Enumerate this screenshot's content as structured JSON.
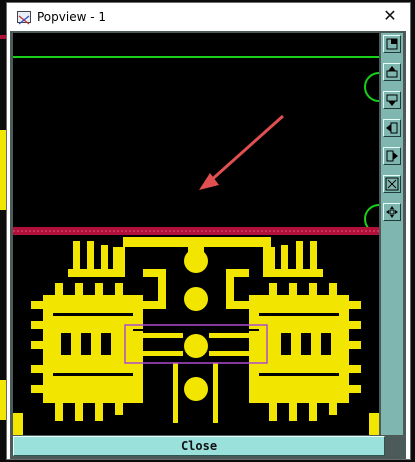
{
  "window": {
    "title": "Popview - 1",
    "close_glyph": "✕",
    "close_button_label": "Close"
  },
  "toolbar": {
    "buttons": [
      {
        "name": "zoom-window-icon"
      },
      {
        "name": "pan-up-icon"
      },
      {
        "name": "pan-down-icon"
      },
      {
        "name": "pan-left-icon"
      },
      {
        "name": "pan-right-icon"
      },
      {
        "name": "zoom-in-icon"
      },
      {
        "name": "zoom-out-icon"
      }
    ]
  },
  "colors": {
    "trace": "#f2e600",
    "outline_green": "#18d018",
    "plane_red": "#b0103a",
    "arrow": "#e05050",
    "toolbar": "#7fb7b0",
    "close_bar": "#9ae0db"
  }
}
